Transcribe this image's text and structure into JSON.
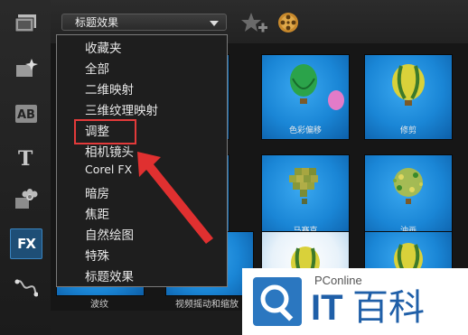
{
  "topbar": {
    "category_value": "标题效果",
    "icons": [
      "add-star-icon",
      "film-reel-icon"
    ]
  },
  "sidebar": {
    "items": [
      {
        "name": "media-library",
        "icon": "filmstrip-icon"
      },
      {
        "name": "instant-project",
        "icon": "sparkle-film-icon"
      },
      {
        "name": "transitions",
        "icon": "ab-transition-icon",
        "label": "AB"
      },
      {
        "name": "title",
        "icon": "title-t-icon",
        "label": "T"
      },
      {
        "name": "graphics",
        "icon": "flower-graphic-icon"
      },
      {
        "name": "filters",
        "icon": "fx-icon",
        "label": "FX",
        "active": true
      },
      {
        "name": "path",
        "icon": "motion-path-icon"
      }
    ]
  },
  "menu": {
    "items": [
      "收藏夹",
      "全部",
      "二维映射",
      "三维纹理映射",
      "调整",
      "相机镜头",
      "Corel FX",
      "暗房",
      "焦距",
      "自然绘图",
      "特殊",
      "标题效果"
    ],
    "highlighted": "调整"
  },
  "grid": {
    "thumbs": [
      {
        "caption": "色彩偏移",
        "label": ""
      },
      {
        "caption": "修剪",
        "label": ""
      },
      {
        "caption": "马赛克",
        "label": ""
      },
      {
        "caption": "油画",
        "label": ""
      },
      {
        "caption": "",
        "label": "波纹"
      },
      {
        "caption": "",
        "label": "视频摇动和缩放"
      }
    ]
  },
  "watermark": {
    "site": "PConline",
    "brand_latin": "IT",
    "brand_cn": "百科"
  },
  "colors": {
    "accent_blue": "#1e4e76",
    "highlight_red": "#e23a3a",
    "thumb_blue": "#1a86d6",
    "watermark_blue": "#1f5fa8"
  }
}
